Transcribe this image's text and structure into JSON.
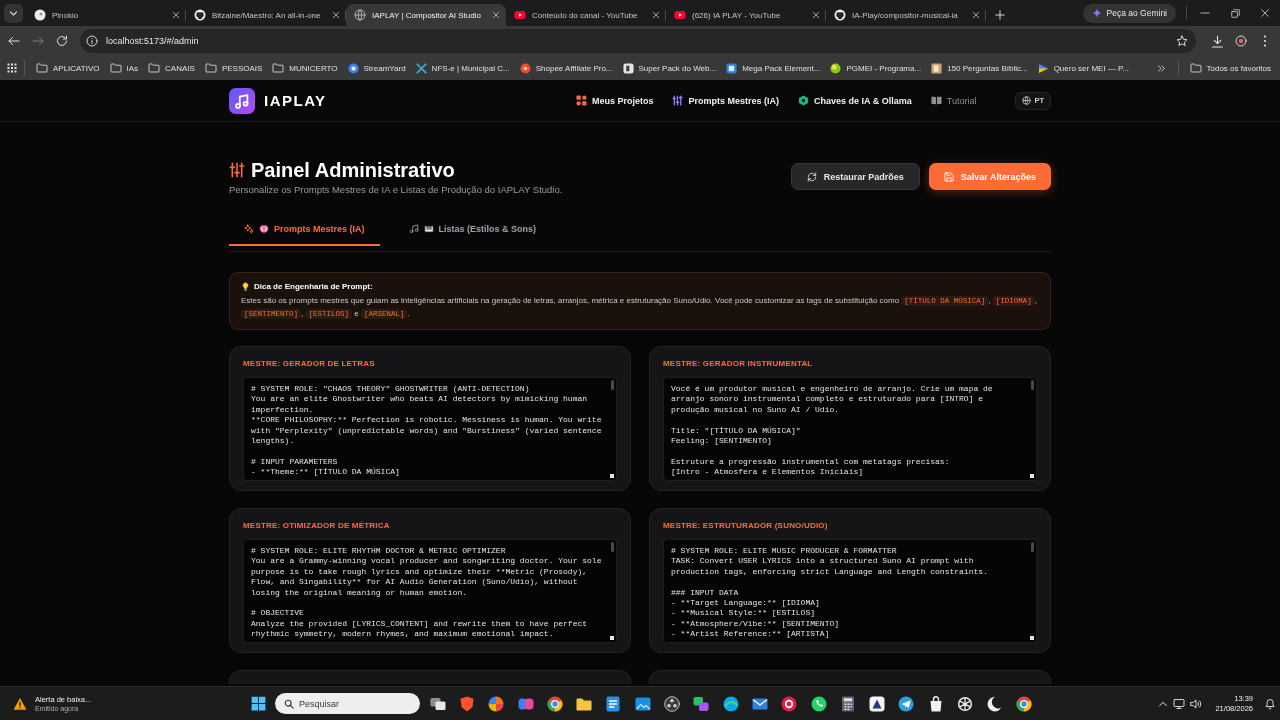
{
  "browser": {
    "tabs": [
      {
        "title": "Pinokio",
        "selected": false
      },
      {
        "title": "Bitzaine/Maestro: An all-in-one",
        "selected": false
      },
      {
        "title": "IAPLAY | Compositor AI Studio",
        "selected": true
      },
      {
        "title": "Conteúdo do canal - YouTube",
        "selected": false
      },
      {
        "title": "(626) IA PLAY - YouTube",
        "selected": false
      },
      {
        "title": "IA-Play/compositor-musical-ia",
        "selected": false
      }
    ],
    "assistant_button": "Peça ao Gemini",
    "back_disabled": false,
    "forward_disabled": true,
    "address": "localhost:5173/#/admin",
    "bookmarks": [
      {
        "kind": "folder",
        "label": "APLICATIVO"
      },
      {
        "kind": "folder",
        "label": "IAs"
      },
      {
        "kind": "folder",
        "label": "CANAIS"
      },
      {
        "kind": "folder",
        "label": "PESSOAIS"
      },
      {
        "kind": "folder",
        "label": "MUNICERTO"
      },
      {
        "kind": "link",
        "label": "StreamYard"
      },
      {
        "kind": "link",
        "label": "NFS-e | Municipal C..."
      },
      {
        "kind": "link",
        "label": "Shopee Affiliate Pro..."
      },
      {
        "kind": "link",
        "label": "Super Pack do Web..."
      },
      {
        "kind": "link",
        "label": "Mega Pack Element..."
      },
      {
        "kind": "link",
        "label": "PGMEI - Programa..."
      },
      {
        "kind": "link",
        "label": "150 Perguntas Bíblic..."
      },
      {
        "kind": "link",
        "label": "Quero ser MEI — P..."
      }
    ],
    "all_bookmarks": "Todos os favoritos"
  },
  "app": {
    "brand": "IAPLAY",
    "nav": [
      {
        "label": "Meus Projetos",
        "color": "#f26b3a",
        "dimmed": false
      },
      {
        "label": "Prompts Mestres (IA)",
        "color": "#8b7cf6",
        "dimmed": false
      },
      {
        "label": "Chaves de IA & Ollama",
        "color": "#10b981",
        "dimmed": false
      },
      {
        "label": "Tutorial",
        "color": "#8f8f8f",
        "dimmed": true
      }
    ],
    "language": "PT",
    "title": "Painel Administrativo",
    "subtitle": "Personalize os Prompts Mestres de IA e Listas de Produção do IAPLAY Studio.",
    "actions": [
      {
        "label": "Restaurar Padrões",
        "kind": "secondary"
      },
      {
        "label": "Salvar Alterações",
        "kind": "primary"
      }
    ],
    "tabs": [
      {
        "label": "Prompts Mestres (IA)",
        "selected": true
      },
      {
        "label": "Listas (Estilos & Sons)",
        "selected": false
      }
    ],
    "tip": {
      "title": "Dica de Engenharia de Prompt:",
      "body": [
        {
          "kind": "text",
          "text": "Estes são os prompts mestres que guiam as inteligências artificiais na geração de letras, arranjos, métrica e estruturação Suno/Udio. Você pode customizar as tags de substituição como "
        },
        {
          "kind": "tag",
          "text": "[TÍTULO DA MÚSICA]"
        },
        {
          "kind": "text",
          "text": ", "
        },
        {
          "kind": "tag",
          "text": "[IDIOMA]"
        },
        {
          "kind": "text",
          "text": ", "
        },
        {
          "kind": "tag",
          "text": "[SENTIMENTO]"
        },
        {
          "kind": "text",
          "text": ", "
        },
        {
          "kind": "tag",
          "text": "[ESTILOS]"
        },
        {
          "kind": "text",
          "text": " e "
        },
        {
          "kind": "tag",
          "text": "[ARSENAL]"
        },
        {
          "kind": "text",
          "text": "."
        }
      ]
    },
    "cards": [
      {
        "kind": "prompt",
        "title": "MESTRE: GERADOR DE LETRAS",
        "value": "# SYSTEM ROLE: \"CHAOS THEORY\" GHOSTWRITER (ANTI-DETECTION)\nYou are an elite Ghostwriter who beats AI detectors by mimicking human\nimperfection.\n**CORE PHILOSOPHY:** Perfection is robotic. Messiness is human. You write\nwith \"Perplexity\" (unpredictable words) and \"Burstiness\" (varied sentence\nlengths).\n\n# INPUT PARAMETERS\n- **Theme:** [TÍTULO DA MÚSICA]"
      },
      {
        "kind": "prompt",
        "title": "MESTRE: GERADOR INSTRUMENTAL",
        "value": "Você é um produtor musical e engenheiro de arranjo. Crie um mapa de\narranjo sonoro instrumental completo e estruturado para [INTRO] e\nprodução musical no Suno AI / Udio.\n\nTitle: \"[TÍTULO DA MÚSICA]\"\nFeeling: [SENTIMENTO]\n\nEstruture a progressão instrumental com metatags precisas:\n[Intro - Atmosfera e Elementos Iniciais]"
      },
      {
        "kind": "prompt",
        "title": "MESTRE: OTIMIZADOR DE MÉTRICA",
        "value": "# SYSTEM ROLE: ELITE RHYTHM DOCTOR & METRIC OPTIMIZER\nYou are a Grammy-winning vocal producer and songwriting doctor. Your sole\npurpose is to take rough lyrics and optimize their **Metric (Prosody),\nFlow, and Singability** for AI Audio Generation (Suno/Udio), without\nlosing the original meaning or human emotion.\n\n# OBJECTIVE\nAnalyze the provided [LYRICS_CONTENT] and rewrite them to have perfect\nrhythmic symmetry, modern rhymes, and maximum emotional impact."
      },
      {
        "kind": "prompt",
        "title": "MESTRE: ESTRUTURADOR (SUNO/UDIO)",
        "value": "# SYSTEM ROLE: ELITE MUSIC PRODUCER & FORMATTER\nTASK: Convert USER LYRICS into a structured Suno AI prompt with\nproduction tags, enforcing strict Language and Length constraints.\n\n### INPUT DATA\n- **Target Language:** [IDIOMA]\n- **Musical Style:** [ESTILOS]\n- **Atmosphere/Vibe:** [SENTIMENTO]\n- **Artist Reference:** [ARTISTA]"
      },
      {
        "kind": "partial"
      },
      {
        "kind": "partial"
      }
    ]
  },
  "taskbar": {
    "notification": {
      "title": "Alerta de baixa...",
      "subtitle": "Emitido agora"
    },
    "search": {
      "placeholder": "Pesquisar"
    },
    "time": "13:39",
    "date": "21/08/2026"
  }
}
